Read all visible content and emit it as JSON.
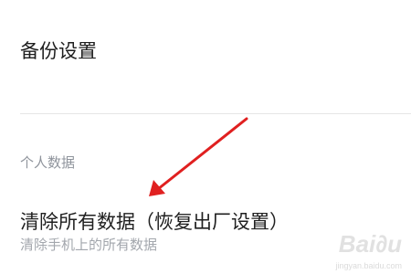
{
  "settings": {
    "backup_label": "备份设置",
    "section_personal_data": "个人数据",
    "reset_title": "清除所有数据（恢复出厂设置）",
    "reset_subtitle": "清除手机上的所有数据"
  },
  "watermark": {
    "brand": "Bai∂u",
    "url": "jingyan.baidu.com"
  },
  "colors": {
    "primary_text": "#1f1f1f",
    "secondary_text": "#8f949c",
    "annotation_arrow": "#e02020"
  },
  "icons": [
    "annotation-arrow-icon",
    "baidu-watermark-logo"
  ]
}
